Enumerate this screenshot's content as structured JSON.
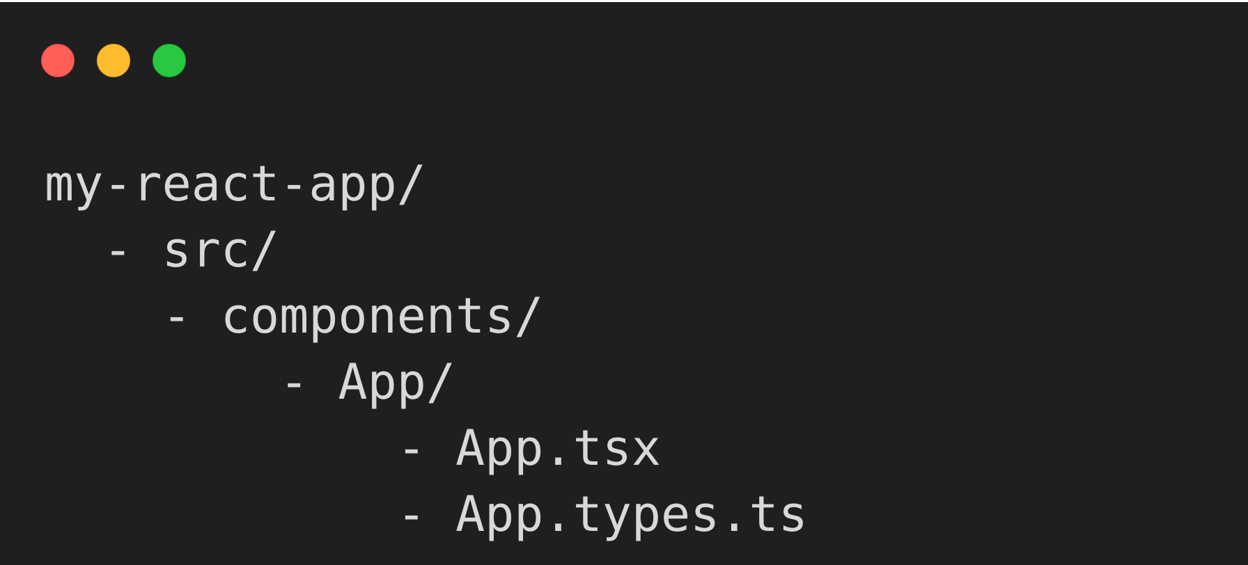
{
  "window": {
    "buttons": [
      {
        "name": "close",
        "color": "#ff5f57"
      },
      {
        "name": "minimize",
        "color": "#febc2e"
      },
      {
        "name": "maximize",
        "color": "#28c840"
      }
    ]
  },
  "code": {
    "lines": [
      "my-react-app/",
      "  - src/",
      "    - components/",
      "        - App/",
      "            - App.tsx",
      "            - App.types.ts"
    ]
  }
}
